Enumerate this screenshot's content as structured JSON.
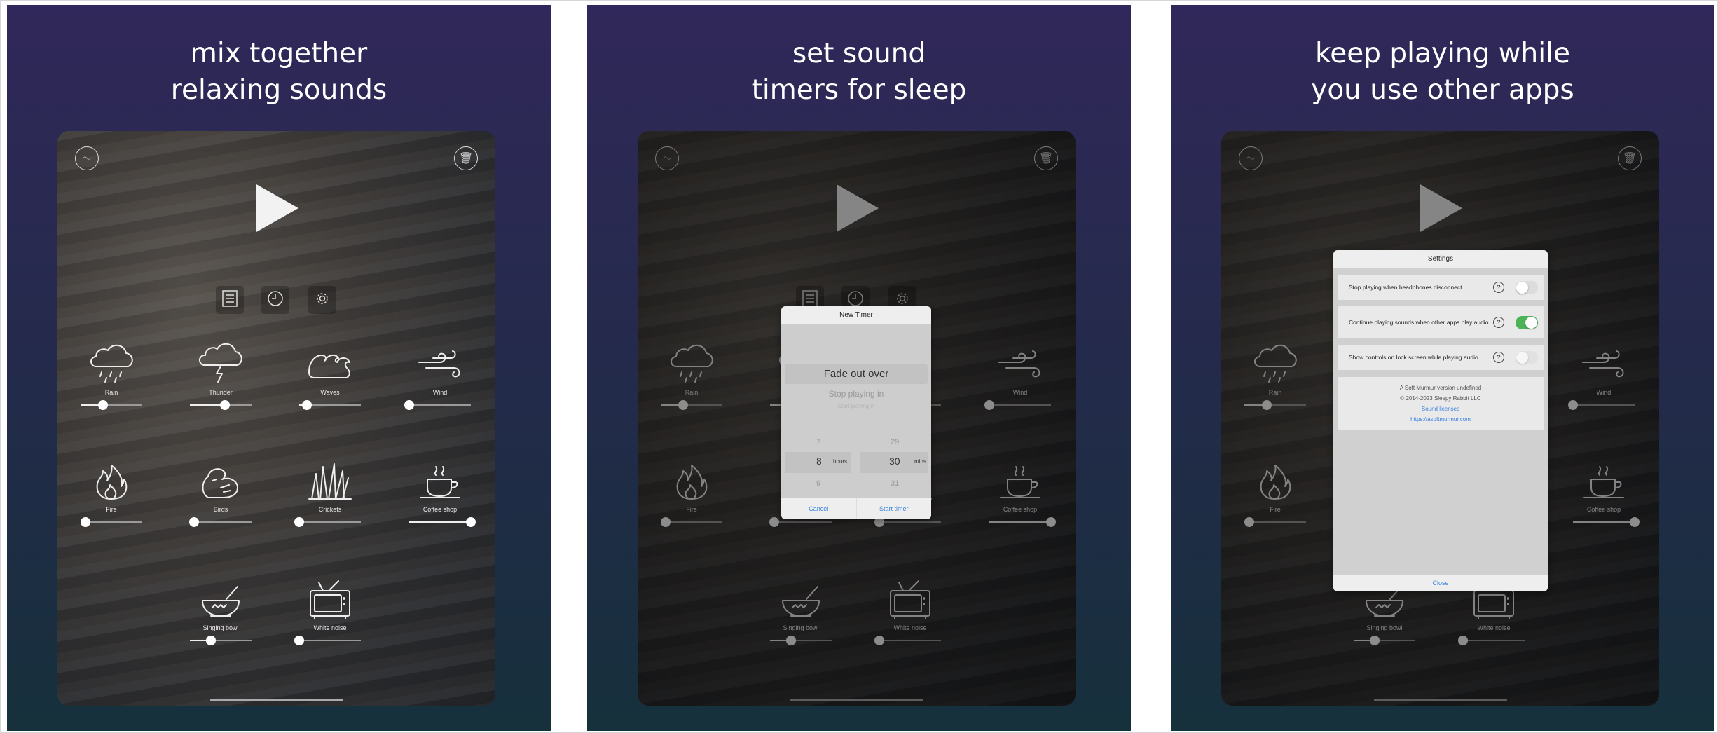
{
  "panels": [
    {
      "headline": [
        "mix together",
        "relaxing sounds"
      ],
      "overlay": "none"
    },
    {
      "headline": [
        "set sound",
        "timers for sleep"
      ],
      "overlay": "timer"
    },
    {
      "headline": [
        "keep playing while",
        "you use other apps"
      ],
      "overlay": "settings"
    }
  ],
  "app": {
    "icons": {
      "top_left": "waveform-icon",
      "top_right": "trash-icon",
      "play": "play-icon",
      "toolbar": [
        "list-icon",
        "clock-icon",
        "gear-icon"
      ]
    },
    "sounds": [
      {
        "label": "Rain",
        "icon": "rain-cloud-icon",
        "volume": 0.36
      },
      {
        "label": "Thunder",
        "icon": "thunder-cloud-icon",
        "volume": 0.57
      },
      {
        "label": "Waves",
        "icon": "waves-icon",
        "volume": 0.12
      },
      {
        "label": "Wind",
        "icon": "wind-icon",
        "volume": 0.0
      },
      {
        "label": "Fire",
        "icon": "fire-icon",
        "volume": 0.08
      },
      {
        "label": "Birds",
        "icon": "bird-icon",
        "volume": 0.07
      },
      {
        "label": "Crickets",
        "icon": "grass-icon",
        "volume": 0.0
      },
      {
        "label": "Coffee shop",
        "icon": "coffee-cup-icon",
        "volume": 1.0
      },
      {
        "label": "Singing bowl",
        "icon": "singing-bowl-icon",
        "volume": 0.34
      },
      {
        "label": "White noise",
        "icon": "tv-icon",
        "volume": 0.0
      }
    ]
  },
  "timer_dialog": {
    "title": "New Timer",
    "modes": [
      "Fade out over",
      "Stop playing in",
      "Start playing in"
    ],
    "hours": {
      "prev": "7",
      "selected": "8",
      "next": "9",
      "unit": "hours"
    },
    "mins": {
      "prev": "29",
      "selected": "30",
      "next": "31",
      "unit": "mins"
    },
    "cancel": "Cancel",
    "start": "Start timer"
  },
  "settings_dialog": {
    "title": "Settings",
    "rows": [
      {
        "label": "Stop playing when headphones disconnect",
        "on": false
      },
      {
        "label": "Continue playing sounds when other apps play audio",
        "on": true
      },
      {
        "label": "Show controls on lock screen while playing audio",
        "on": false
      }
    ],
    "help": "?",
    "about": [
      "A Soft Murmur version undefined",
      "© 2014-2023 Sleepy Rabbit LLC"
    ],
    "links": [
      "Sound licenses",
      "https://asoftmurmur.com"
    ],
    "close": "Close"
  },
  "colors": {
    "accent_blue": "#3b83e0",
    "toggle_on": "#4cb454"
  }
}
